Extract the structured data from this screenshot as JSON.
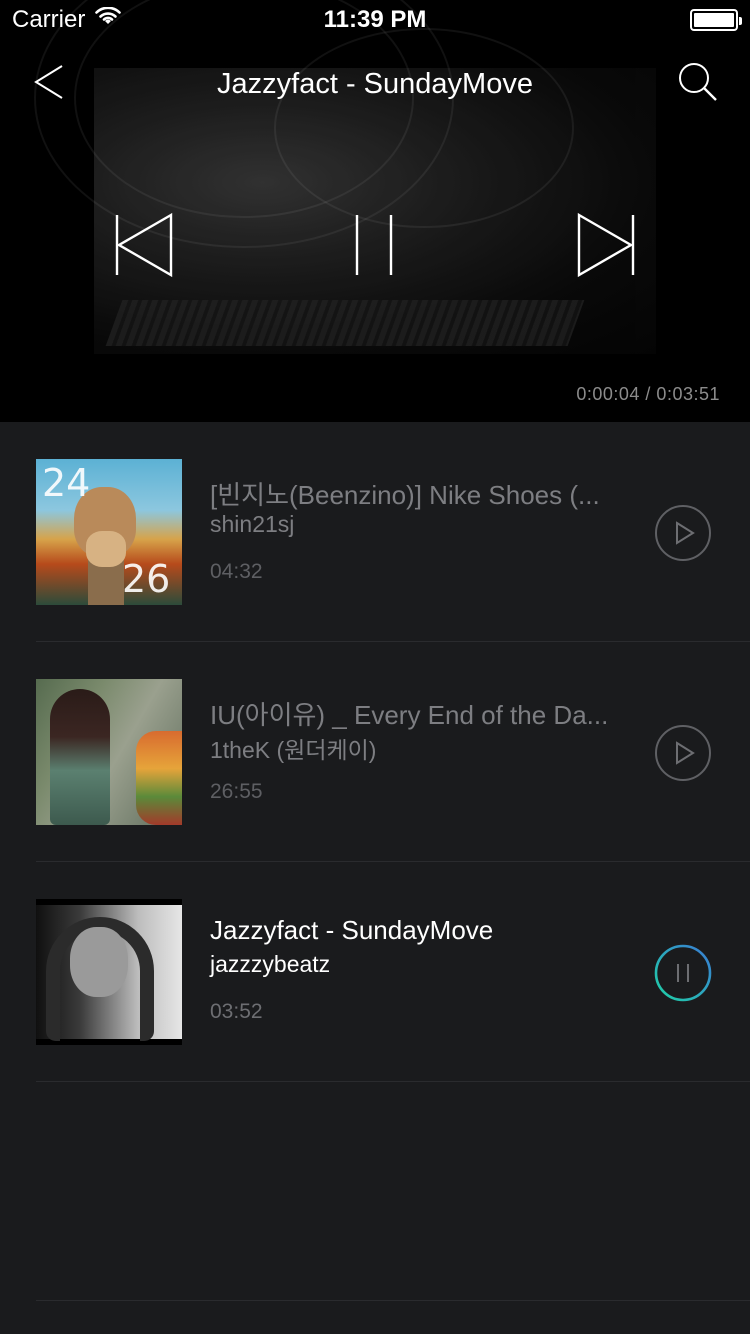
{
  "status_bar": {
    "carrier": "Carrier",
    "time": "11:39 PM"
  },
  "player": {
    "title": "Jazzyfact - SundayMove",
    "time_readout": "0:00:04 / 0:03:51",
    "icons": {
      "back": "chevron-left-icon",
      "search": "search-icon",
      "prev": "skip-previous-icon",
      "pause": "pause-icon",
      "next": "skip-next-icon"
    }
  },
  "playlist": [
    {
      "title": "[빈지노(Beenzino)] Nike Shoes (...",
      "channel": "shin21sj",
      "duration": "04:32",
      "state": "idle",
      "thumb_numbers": [
        "24",
        "26"
      ],
      "button_icon": "play-icon"
    },
    {
      "title": "IU(아이유) _ Every End of the Da...",
      "channel": "1theK (원더케이)",
      "duration": "26:55",
      "state": "idle",
      "button_icon": "play-icon"
    },
    {
      "title": "Jazzyfact - SundayMove",
      "channel": "jazzzybeatz",
      "duration": "03:52",
      "state": "playing",
      "button_icon": "pause-icon"
    }
  ],
  "colors": {
    "background": "#1a1b1d",
    "player_background": "#000000",
    "dim_text": "#7d7e82",
    "active_ring_start": "#1fd1a6",
    "active_ring_end": "#3a7bd5"
  }
}
